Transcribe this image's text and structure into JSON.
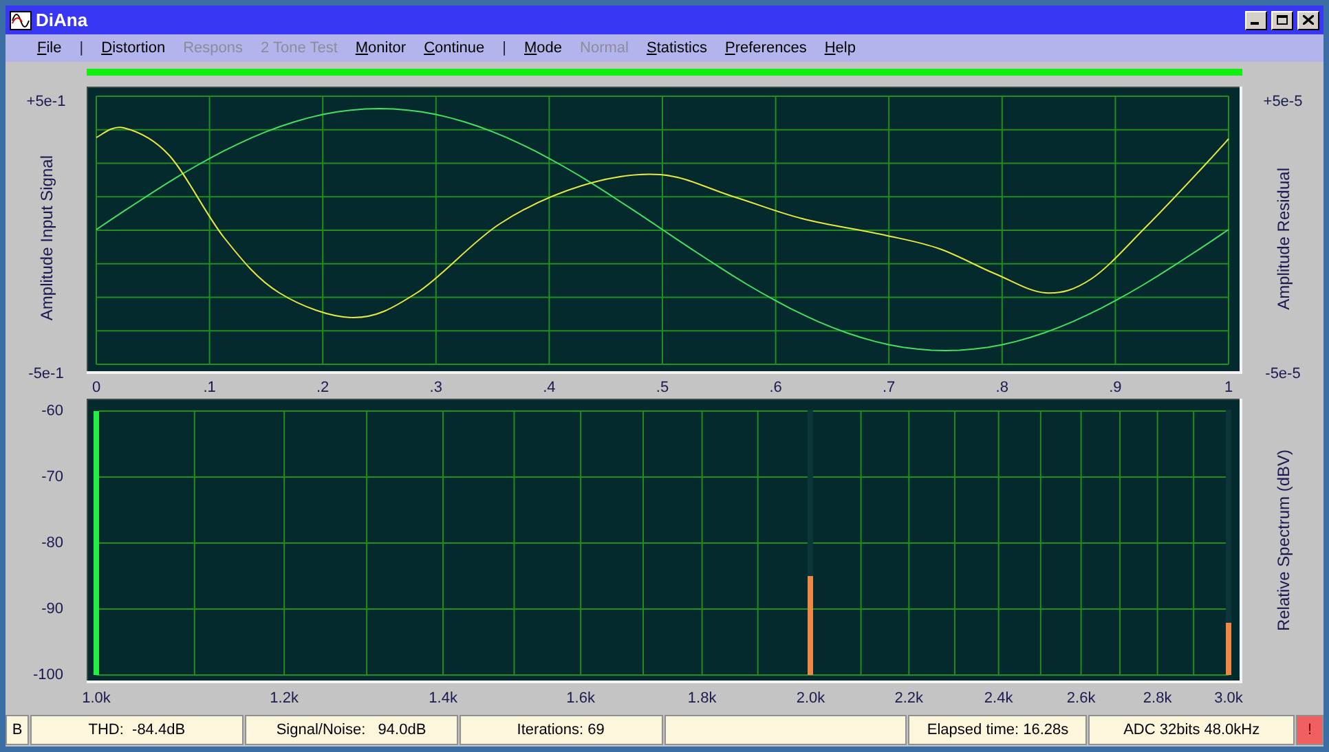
{
  "window": {
    "title": "DiAna"
  },
  "menu": [
    {
      "kind": "item",
      "label": "File",
      "disabled": false
    },
    {
      "kind": "separator",
      "label": "|"
    },
    {
      "kind": "item",
      "label": "Distortion",
      "disabled": false
    },
    {
      "kind": "item",
      "label": "Respons",
      "disabled": true
    },
    {
      "kind": "item",
      "label": "2 Tone Test",
      "disabled": true
    },
    {
      "kind": "item",
      "label": "Monitor",
      "disabled": false
    },
    {
      "kind": "item",
      "label": "Continue",
      "disabled": false
    },
    {
      "kind": "separator",
      "label": "|"
    },
    {
      "kind": "item",
      "label": "Mode",
      "disabled": false
    },
    {
      "kind": "item",
      "label": "Normal",
      "disabled": true
    },
    {
      "kind": "item",
      "label": "Statistics",
      "disabled": false
    },
    {
      "kind": "item",
      "label": "Preferences",
      "disabled": false
    },
    {
      "kind": "item",
      "label": "Help",
      "disabled": false
    }
  ],
  "signal_chart": {
    "left_label": "Amplitude Input Signal",
    "right_label": "Amplitude Residual",
    "left_ticks": [
      "+5e-1",
      "-5e-1"
    ],
    "right_ticks": [
      "+5e-5",
      "-5e-5"
    ],
    "x_ticks": [
      "0",
      ".1",
      ".2",
      ".3",
      ".4",
      ".5",
      ".6",
      ".7",
      ".8",
      ".9",
      "1"
    ]
  },
  "spectrum_chart": {
    "axis_label": "Relative Spectrum (dBV)",
    "y_ticks": [
      "-60",
      "-70",
      "-80",
      "-90",
      "-100"
    ],
    "x_ticks": [
      {
        "label": "1.0k",
        "peak": {
          "level": 1,
          "color": "#22ee44"
        }
      },
      {
        "label": "1.2k"
      },
      {
        "label": "1.4k"
      },
      {
        "label": "1.6k"
      },
      {
        "label": "1.8k"
      },
      {
        "label": "2.0k",
        "peak": {
          "level": 0.375,
          "color": "#ee8844"
        }
      },
      {
        "label": "2.2k"
      },
      {
        "label": "2.4k"
      },
      {
        "label": "2.6k"
      },
      {
        "label": "2.8k"
      },
      {
        "label": "3.0k",
        "peak": {
          "level": 0.2,
          "color": "#ee8844"
        }
      }
    ]
  },
  "status_bar": [
    {
      "kind": "text",
      "text": "B"
    },
    {
      "kind": "text",
      "text": "THD:  -84.4dB"
    },
    {
      "kind": "text",
      "text": "Signal/Noise:   94.0dB"
    },
    {
      "kind": "text",
      "text": "Iterations: 69"
    },
    {
      "kind": "blank"
    },
    {
      "kind": "text",
      "text": "Elapsed time: 16.28s"
    },
    {
      "kind": "text",
      "text": "ADC 32bits 48.0kHz"
    },
    {
      "kind": "alert",
      "text": "!"
    }
  ]
}
